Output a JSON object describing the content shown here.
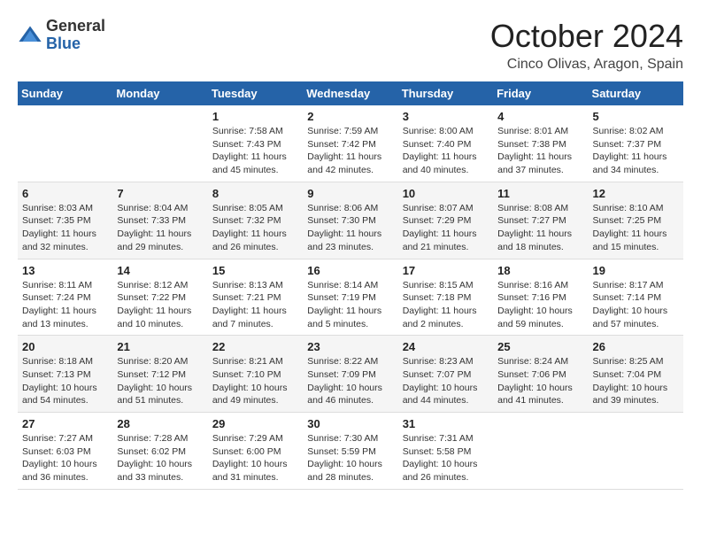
{
  "logo": {
    "general": "General",
    "blue": "Blue"
  },
  "header": {
    "title": "October 2024",
    "subtitle": "Cinco Olivas, Aragon, Spain"
  },
  "weekdays": [
    "Sunday",
    "Monday",
    "Tuesday",
    "Wednesday",
    "Thursday",
    "Friday",
    "Saturday"
  ],
  "weeks": [
    [
      {
        "day": "",
        "info": ""
      },
      {
        "day": "",
        "info": ""
      },
      {
        "day": "1",
        "info": "Sunrise: 7:58 AM\nSunset: 7:43 PM\nDaylight: 11 hours and 45 minutes."
      },
      {
        "day": "2",
        "info": "Sunrise: 7:59 AM\nSunset: 7:42 PM\nDaylight: 11 hours and 42 minutes."
      },
      {
        "day": "3",
        "info": "Sunrise: 8:00 AM\nSunset: 7:40 PM\nDaylight: 11 hours and 40 minutes."
      },
      {
        "day": "4",
        "info": "Sunrise: 8:01 AM\nSunset: 7:38 PM\nDaylight: 11 hours and 37 minutes."
      },
      {
        "day": "5",
        "info": "Sunrise: 8:02 AM\nSunset: 7:37 PM\nDaylight: 11 hours and 34 minutes."
      }
    ],
    [
      {
        "day": "6",
        "info": "Sunrise: 8:03 AM\nSunset: 7:35 PM\nDaylight: 11 hours and 32 minutes."
      },
      {
        "day": "7",
        "info": "Sunrise: 8:04 AM\nSunset: 7:33 PM\nDaylight: 11 hours and 29 minutes."
      },
      {
        "day": "8",
        "info": "Sunrise: 8:05 AM\nSunset: 7:32 PM\nDaylight: 11 hours and 26 minutes."
      },
      {
        "day": "9",
        "info": "Sunrise: 8:06 AM\nSunset: 7:30 PM\nDaylight: 11 hours and 23 minutes."
      },
      {
        "day": "10",
        "info": "Sunrise: 8:07 AM\nSunset: 7:29 PM\nDaylight: 11 hours and 21 minutes."
      },
      {
        "day": "11",
        "info": "Sunrise: 8:08 AM\nSunset: 7:27 PM\nDaylight: 11 hours and 18 minutes."
      },
      {
        "day": "12",
        "info": "Sunrise: 8:10 AM\nSunset: 7:25 PM\nDaylight: 11 hours and 15 minutes."
      }
    ],
    [
      {
        "day": "13",
        "info": "Sunrise: 8:11 AM\nSunset: 7:24 PM\nDaylight: 11 hours and 13 minutes."
      },
      {
        "day": "14",
        "info": "Sunrise: 8:12 AM\nSunset: 7:22 PM\nDaylight: 11 hours and 10 minutes."
      },
      {
        "day": "15",
        "info": "Sunrise: 8:13 AM\nSunset: 7:21 PM\nDaylight: 11 hours and 7 minutes."
      },
      {
        "day": "16",
        "info": "Sunrise: 8:14 AM\nSunset: 7:19 PM\nDaylight: 11 hours and 5 minutes."
      },
      {
        "day": "17",
        "info": "Sunrise: 8:15 AM\nSunset: 7:18 PM\nDaylight: 11 hours and 2 minutes."
      },
      {
        "day": "18",
        "info": "Sunrise: 8:16 AM\nSunset: 7:16 PM\nDaylight: 10 hours and 59 minutes."
      },
      {
        "day": "19",
        "info": "Sunrise: 8:17 AM\nSunset: 7:14 PM\nDaylight: 10 hours and 57 minutes."
      }
    ],
    [
      {
        "day": "20",
        "info": "Sunrise: 8:18 AM\nSunset: 7:13 PM\nDaylight: 10 hours and 54 minutes."
      },
      {
        "day": "21",
        "info": "Sunrise: 8:20 AM\nSunset: 7:12 PM\nDaylight: 10 hours and 51 minutes."
      },
      {
        "day": "22",
        "info": "Sunrise: 8:21 AM\nSunset: 7:10 PM\nDaylight: 10 hours and 49 minutes."
      },
      {
        "day": "23",
        "info": "Sunrise: 8:22 AM\nSunset: 7:09 PM\nDaylight: 10 hours and 46 minutes."
      },
      {
        "day": "24",
        "info": "Sunrise: 8:23 AM\nSunset: 7:07 PM\nDaylight: 10 hours and 44 minutes."
      },
      {
        "day": "25",
        "info": "Sunrise: 8:24 AM\nSunset: 7:06 PM\nDaylight: 10 hours and 41 minutes."
      },
      {
        "day": "26",
        "info": "Sunrise: 8:25 AM\nSunset: 7:04 PM\nDaylight: 10 hours and 39 minutes."
      }
    ],
    [
      {
        "day": "27",
        "info": "Sunrise: 7:27 AM\nSunset: 6:03 PM\nDaylight: 10 hours and 36 minutes."
      },
      {
        "day": "28",
        "info": "Sunrise: 7:28 AM\nSunset: 6:02 PM\nDaylight: 10 hours and 33 minutes."
      },
      {
        "day": "29",
        "info": "Sunrise: 7:29 AM\nSunset: 6:00 PM\nDaylight: 10 hours and 31 minutes."
      },
      {
        "day": "30",
        "info": "Sunrise: 7:30 AM\nSunset: 5:59 PM\nDaylight: 10 hours and 28 minutes."
      },
      {
        "day": "31",
        "info": "Sunrise: 7:31 AM\nSunset: 5:58 PM\nDaylight: 10 hours and 26 minutes."
      },
      {
        "day": "",
        "info": ""
      },
      {
        "day": "",
        "info": ""
      }
    ]
  ]
}
